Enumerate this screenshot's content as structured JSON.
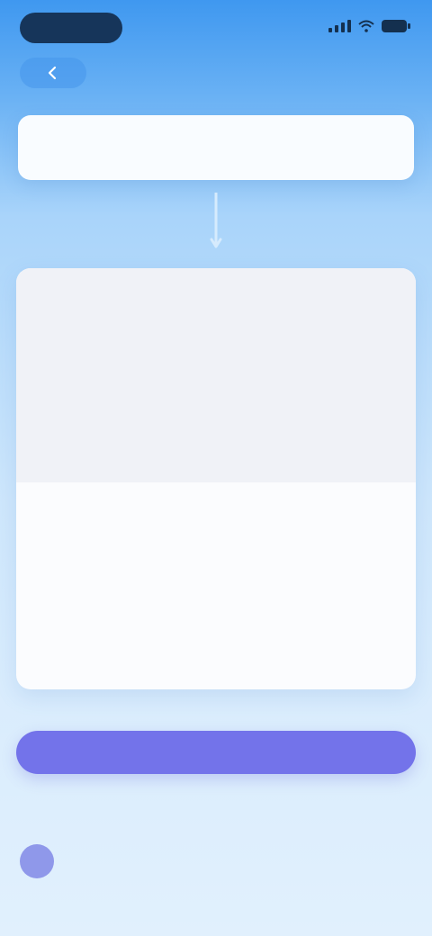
{
  "balance": {
    "label": "",
    "prefix": "",
    "amount": ""
  },
  "form": {
    "heading": "",
    "subheading": "",
    "group": "",
    "rows": [
      {
        "label": "",
        "value": ""
      },
      {
        "label": "",
        "value": ""
      },
      {
        "label": "",
        "value": ""
      }
    ],
    "note": "",
    "input_value": "",
    "input_placeholder": ""
  },
  "actions": {
    "confirm_label": "",
    "link_text": ""
  },
  "agreement": {
    "text": "",
    "link": ""
  },
  "colors": {
    "accent": "#7373ea",
    "balance_amount": "#e8464f",
    "checkbox": "#8f98ea"
  },
  "icons": {
    "back": "back-arrow-icon",
    "signal": "signal-icon",
    "wifi": "wifi-icon",
    "battery": "battery-icon"
  }
}
